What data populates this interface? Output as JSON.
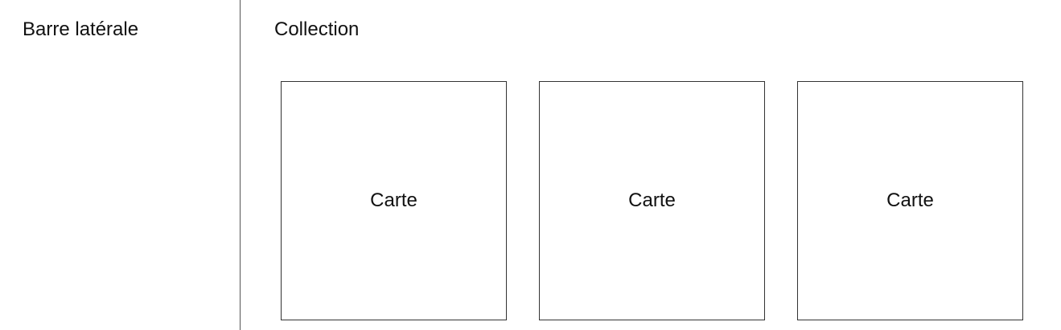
{
  "sidebar": {
    "title": "Barre latérale"
  },
  "main": {
    "title": "Collection",
    "cards": [
      {
        "label": "Carte"
      },
      {
        "label": "Carte"
      },
      {
        "label": "Carte"
      }
    ]
  }
}
